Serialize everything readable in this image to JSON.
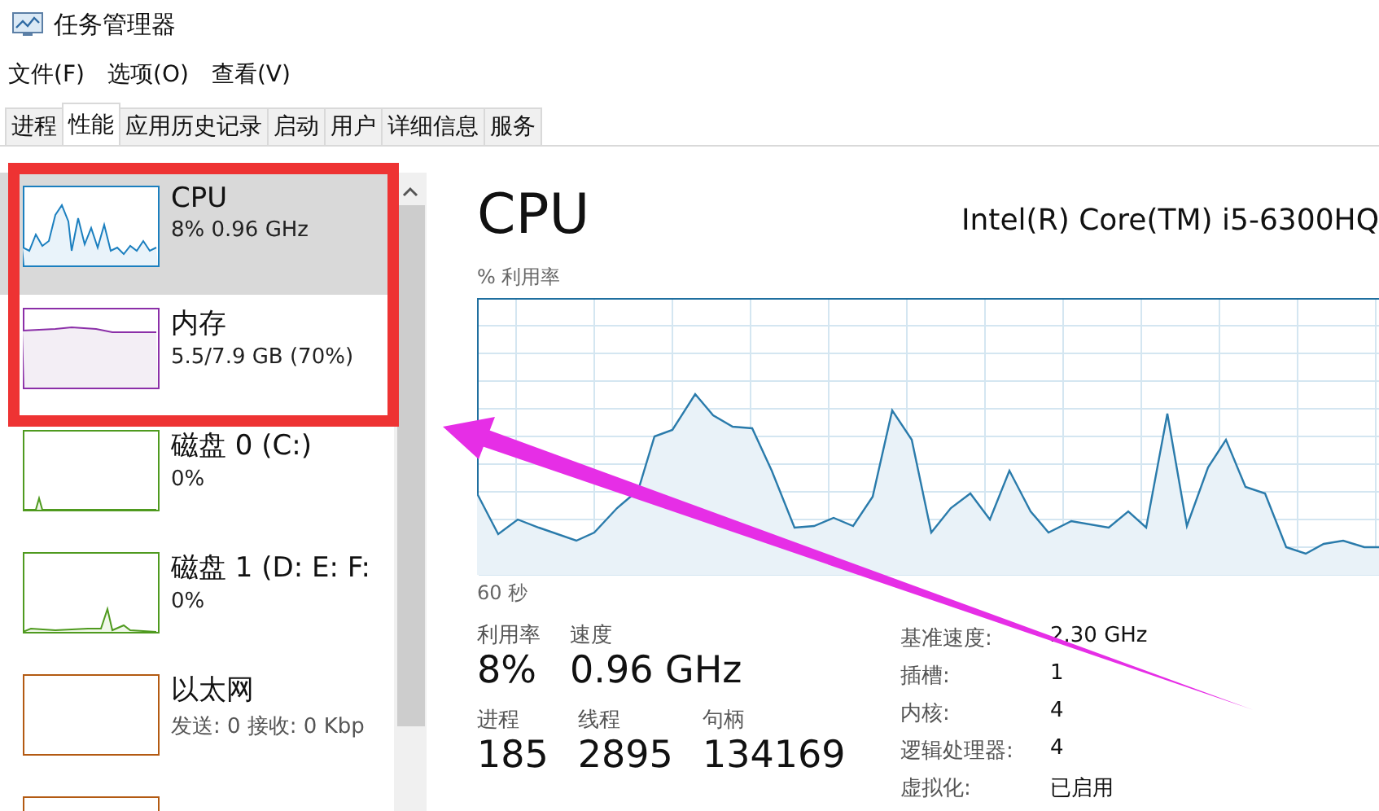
{
  "window": {
    "title": "任务管理器"
  },
  "menu": [
    "文件(F)",
    "选项(O)",
    "查看(V)"
  ],
  "tabs": [
    {
      "label": "进程",
      "selected": false
    },
    {
      "label": "性能",
      "selected": true
    },
    {
      "label": "应用历史记录",
      "selected": false
    },
    {
      "label": "启动",
      "selected": false
    },
    {
      "label": "用户",
      "selected": false
    },
    {
      "label": "详细信息",
      "selected": false
    },
    {
      "label": "服务",
      "selected": false
    }
  ],
  "sidebar": {
    "items": [
      {
        "kind": "cpu",
        "name": "CPU",
        "detail": "8% 0.96 GHz",
        "selected": true
      },
      {
        "kind": "memory",
        "name": "内存",
        "detail": "5.5/7.9 GB (70%)",
        "selected": false
      },
      {
        "kind": "disk",
        "name": "磁盘 0 (C:)",
        "detail": "0%",
        "selected": false
      },
      {
        "kind": "disk2",
        "name": "磁盘 1 (D: E: F:",
        "detail": "0%",
        "selected": false
      },
      {
        "kind": "ethernet",
        "name": "以太网",
        "detail": "发送: 0 接收: 0 Kbp",
        "selected": false
      },
      {
        "kind": "ethernet",
        "selected": false
      }
    ]
  },
  "detail": {
    "title": "CPU",
    "model": "Intel(R) Core(TM) i5-6300HQ",
    "chart_label": "% 利用率",
    "time_label": "60 秒",
    "stats_row_1": [
      {
        "label": "利用率",
        "value": "8%"
      },
      {
        "label": "速度",
        "value": "0.96 GHz"
      }
    ],
    "stats_row_2": [
      {
        "label": "进程",
        "value": "185"
      },
      {
        "label": "线程",
        "value": "2895"
      },
      {
        "label": "句柄",
        "value": "134169"
      }
    ],
    "specs": [
      {
        "label": "基准速度:",
        "value": "2.30 GHz"
      },
      {
        "label": "插槽:",
        "value": "1"
      },
      {
        "label": "内核:",
        "value": "4"
      },
      {
        "label": "逻辑处理器:",
        "value": "4"
      },
      {
        "label": "虚拟化:",
        "value": "已启用"
      }
    ]
  }
}
